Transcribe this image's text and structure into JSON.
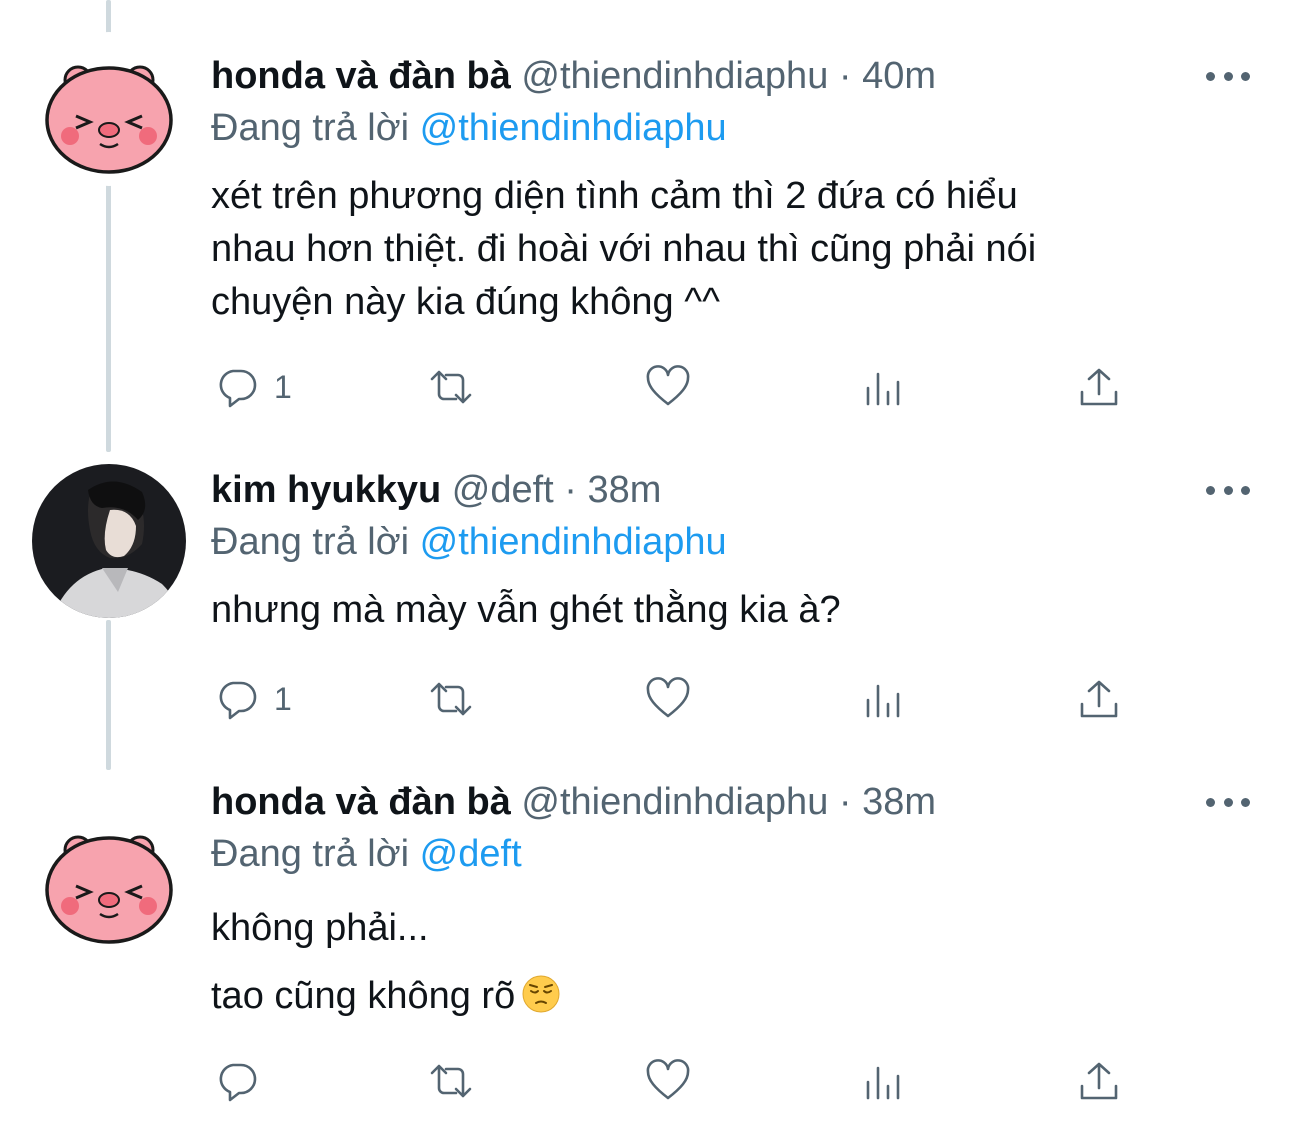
{
  "tweets": [
    {
      "display_name": "honda và đàn bà",
      "handle_time": "@thiendinhdiaphu · 40m",
      "replying_prefix": "Đang trả lời",
      "replying_to": "@thiendinhdiaphu",
      "lines": [
        "xét trên phương diện tình cảm thì 2 đứa có hiểu",
        "nhau hơn thiệt. đi hoài với nhau thì cũng phải nói",
        "chuyện này kia đúng không ^^"
      ],
      "reply_count": "1",
      "avatar": "pink-bear-avatar"
    },
    {
      "display_name": "kim hyukkyu",
      "handle_time": "@deft · 38m",
      "replying_prefix": "Đang trả lời",
      "replying_to": "@thiendinhdiaphu",
      "lines": [
        "nhưng mà mày vẫn ghét thằng kia à?"
      ],
      "reply_count": "1",
      "avatar": "photo-avatar"
    },
    {
      "display_name": "honda và đàn bà",
      "handle_time": "@thiendinhdiaphu · 38m",
      "replying_prefix": "Đang trả lời",
      "replying_to": "@deft",
      "lines": [
        "không phải...",
        "tao cũng không rõ"
      ],
      "reply_count": "",
      "avatar": "pink-bear-avatar"
    }
  ],
  "icons": {
    "reply": "reply-icon",
    "retweet": "retweet-icon",
    "like": "heart-icon",
    "views": "views-icon",
    "share": "share-icon",
    "more": "more-icon",
    "emoji": "pensive-face-emoji"
  },
  "colors": {
    "text": "#0f1419",
    "secondary": "#536471",
    "link": "#1d9bf0",
    "thread_line": "#cfd9de"
  }
}
